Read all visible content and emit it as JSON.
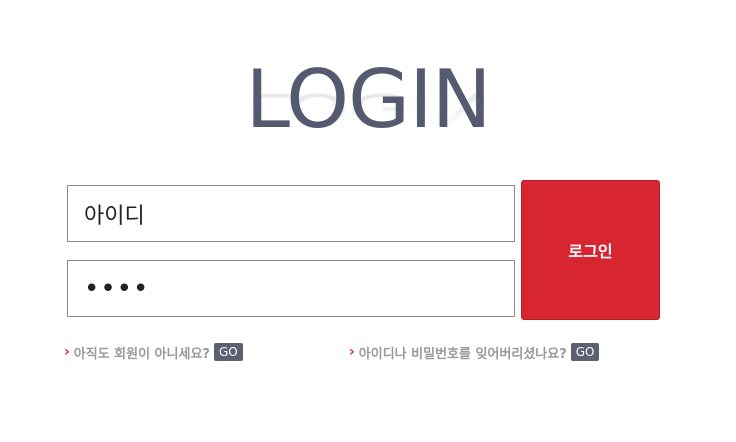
{
  "header": {
    "title": "LOGIN"
  },
  "form": {
    "id_value": "아이디",
    "password_value": "••••",
    "login_label": "로그인"
  },
  "links": {
    "signup_text": "아직도 회원이 아니세요?",
    "signup_go": "GO",
    "recover_text": "아이디나 비밀번호를 잊어버리셨나요?",
    "recover_go": "GO"
  },
  "icons": {
    "bullet": "chevron-right-icon"
  },
  "colors": {
    "title": "#555a70",
    "accent": "#d72631",
    "go_button": "#5c6072",
    "link_text": "#9a9a9a"
  }
}
